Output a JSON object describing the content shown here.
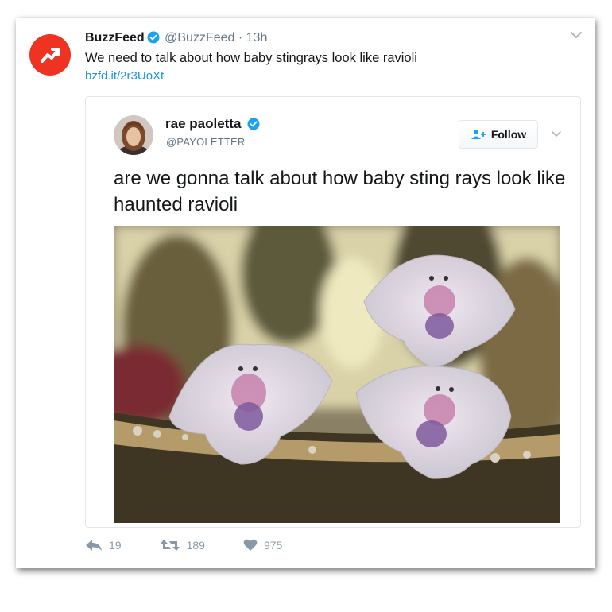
{
  "tweet": {
    "author_name": "BuzzFeed",
    "author_handle": "@BuzzFeed",
    "separator": "·",
    "time": "13h",
    "text": "We need to talk about how baby stingrays look like ravioli",
    "link": "bzfd.it/2r3UoXt"
  },
  "quoted": {
    "author_name": "rae paoletta",
    "author_handle": "@PAYOLETTER",
    "follow_label": "Follow",
    "text": "are we gonna talk about how baby sting rays look like haunted ravioli"
  },
  "actions": {
    "replies": "19",
    "retweets": "189",
    "likes": "975"
  },
  "colors": {
    "brand": "#ee3322",
    "link": "#1b95e0",
    "verified": "#1da1f2",
    "muted": "#8899a6"
  },
  "icons": [
    "buzzfeed-trending-icon",
    "verified-icon",
    "chevron-down-icon",
    "follow-user-plus-icon",
    "reply-icon",
    "retweet-icon",
    "heart-icon"
  ]
}
